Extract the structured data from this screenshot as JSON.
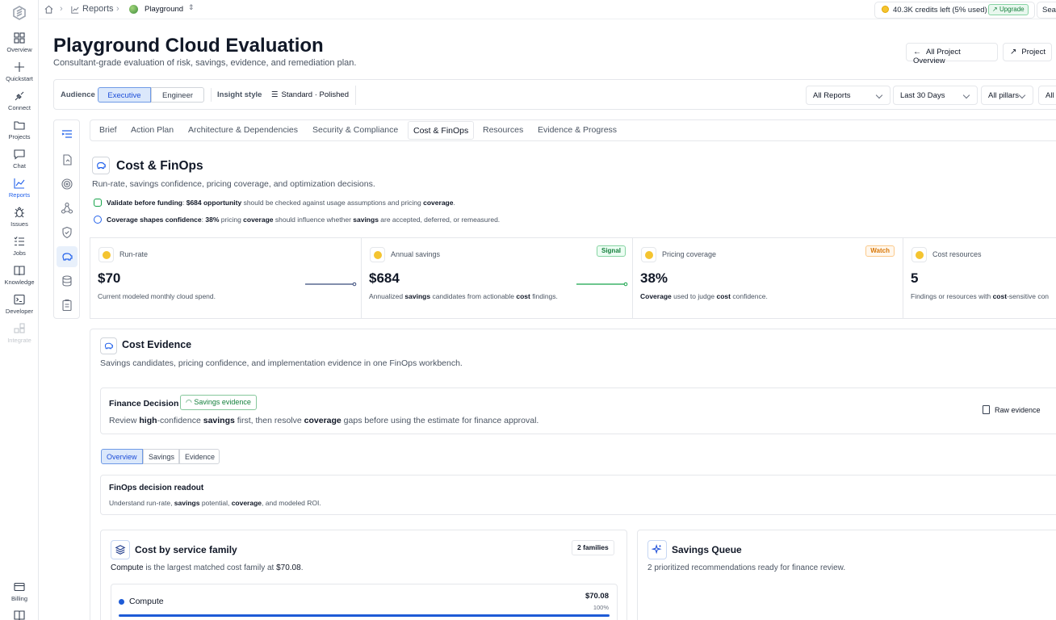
{
  "nav": {
    "items": [
      {
        "label": "Overview",
        "icon": "grid-icon"
      },
      {
        "label": "Quickstart",
        "icon": "plus-icon"
      },
      {
        "label": "Connect",
        "icon": "plug-icon"
      },
      {
        "label": "Projects",
        "icon": "folder-icon"
      },
      {
        "label": "Chat",
        "icon": "chat-icon"
      },
      {
        "label": "Reports",
        "icon": "chart-line-icon"
      },
      {
        "label": "Issues",
        "icon": "bug-icon"
      },
      {
        "label": "Jobs",
        "icon": "list-check-icon"
      },
      {
        "label": "Knowledge",
        "icon": "book-icon"
      },
      {
        "label": "Developer",
        "icon": "terminal-icon"
      },
      {
        "label": "Integrate",
        "icon": "integrate-icon"
      }
    ],
    "billing": "Billing"
  },
  "breadcrumb": {
    "reports": "Reports",
    "project": "Playground"
  },
  "credits": {
    "text": "40.3K credits left (5% used)",
    "upgrade": "Upgrade",
    "search": "Search"
  },
  "page": {
    "title": "Playground Cloud Evaluation",
    "subtitle": "Consultant-grade evaluation of risk, savings, evidence, and remediation plan.",
    "btn_overview": "All Project Overview",
    "btn_project": "Project"
  },
  "filters": {
    "audience_label": "Audience",
    "audience_options": [
      "Executive",
      "Engineer"
    ],
    "audience_selected": "Executive",
    "insight_label": "Insight style",
    "insight_value": "Standard · Polished",
    "reports": "All Reports",
    "range": "Last 30 Days",
    "pillars": "All pillars",
    "more": "All"
  },
  "tabs": [
    "Brief",
    "Action Plan",
    "Architecture & Dependencies",
    "Security & Compliance",
    "Cost & FinOps",
    "Resources",
    "Evidence & Progress"
  ],
  "active_tab": "Cost & FinOps",
  "cost": {
    "title": "Cost & FinOps",
    "subtitle": "Run-rate, savings confidence, pricing coverage, and optimization decisions.",
    "note1_head": "Validate before funding",
    "note1_a": ": ",
    "note1_b": "$684 opportunity",
    "note1_c": " should be checked against usage assumptions and pricing ",
    "note1_d": "coverage",
    "note1_e": ".",
    "note2_head": "Coverage shapes confidence",
    "note2_a": ": ",
    "note2_b": "38%",
    "note2_c": " pricing ",
    "note2_d": "coverage",
    "note2_e": " should influence whether ",
    "note2_f": "savings",
    "note2_g": " are accepted, deferred, or remeasured."
  },
  "metrics": [
    {
      "label": "Run-rate",
      "value": "$70",
      "desc": "Current modeled monthly cloud spend.",
      "badge": "",
      "line_color": "#374a7a"
    },
    {
      "label": "Annual savings",
      "value": "$684",
      "desc_a": "Annualized ",
      "desc_b": "savings",
      "desc_c": " candidates from actionable ",
      "desc_d": "cost",
      "desc_e": " findings.",
      "badge": "Signal",
      "line_color": "#16a34a"
    },
    {
      "label": "Pricing coverage",
      "value": "38%",
      "desc_a": "Coverage",
      "desc_b": " used to judge ",
      "desc_c": "cost",
      "desc_d": " confidence.",
      "badge": "Watch"
    },
    {
      "label": "Cost resources",
      "value": "5",
      "desc_a": "Findings or resources with ",
      "desc_b": "cost",
      "desc_c": "-sensitive con"
    }
  ],
  "evidence": {
    "title": "Cost Evidence",
    "subtitle": "Savings candidates, pricing confidence, and implementation evidence in one FinOps workbench.",
    "decision_title": "Finance Decision",
    "decision_tag": "Savings evidence",
    "decision_a": "Review ",
    "decision_b": "high",
    "decision_c": "-confidence ",
    "decision_d": "savings",
    "decision_e": " first, then resolve ",
    "decision_f": "coverage",
    "decision_g": " gaps before using the estimate for finance approval.",
    "raw_btn": "Raw evidence",
    "subtabs": [
      "Overview",
      "Savings",
      "Evidence"
    ],
    "readout_title": "FinOps decision readout",
    "readout_a": "Understand run-rate, ",
    "readout_b": "savings",
    "readout_c": " potential, ",
    "readout_d": "coverage",
    "readout_e": ", and modeled ROI."
  },
  "service": {
    "title": "Cost by service family",
    "badge": "2 families",
    "desc_a": "Compute",
    "desc_b": " is the largest matched cost family at ",
    "desc_c": "$70.08",
    "desc_d": ".",
    "row_name": "Compute",
    "row_value": "$70.08",
    "row_pct": "100%",
    "row_share": 1.0
  },
  "queue": {
    "title": "Savings Queue",
    "desc": "2 prioritized recommendations ready for finance review."
  }
}
